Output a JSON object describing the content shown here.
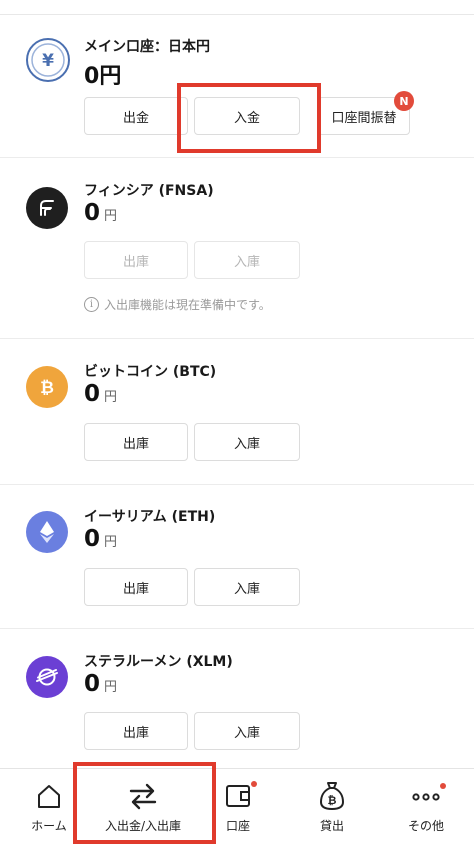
{
  "main_account": {
    "title": "メイン口座：日本円",
    "balance_num": "0",
    "balance_unit": "円",
    "withdraw_label": "出金",
    "deposit_label": "入金",
    "transfer_label": "口座間振替",
    "transfer_badge": "N",
    "icon": "yen-icon"
  },
  "assets": [
    {
      "name": "フィンシア (FNSA)",
      "amount": "0",
      "unit": "円",
      "out_label": "出庫",
      "in_label": "入庫",
      "disabled": true,
      "notice_icon": "i",
      "notice": "入出庫機能は現在準備中です。",
      "icon": "finschia-icon",
      "color": "#1f1f1f"
    },
    {
      "name": "ビットコイン (BTC)",
      "amount": "0",
      "unit": "円",
      "out_label": "出庫",
      "in_label": "入庫",
      "icon": "bitcoin-icon",
      "color": "#f0a53c"
    },
    {
      "name": "イーサリアム (ETH)",
      "amount": "0",
      "unit": "円",
      "out_label": "出庫",
      "in_label": "入庫",
      "icon": "ethereum-icon",
      "color": "#6a7fe0"
    },
    {
      "name": "ステラルーメン (XLM)",
      "amount": "0",
      "unit": "円",
      "out_label": "出庫",
      "in_label": "入庫",
      "icon": "stellar-icon",
      "color": "#6b3fd4"
    }
  ],
  "tabbar": {
    "items": [
      {
        "label": "ホーム",
        "icon": "home-icon"
      },
      {
        "label": "入出金/入出庫",
        "icon": "transfer-arrows-icon",
        "active": true
      },
      {
        "label": "口座",
        "icon": "wallet-icon",
        "dot": true
      },
      {
        "label": "貸出",
        "icon": "money-bag-icon"
      },
      {
        "label": "その他",
        "icon": "more-dots-icon",
        "dot": true
      }
    ]
  },
  "colors": {
    "highlight": "#e03a2c",
    "badge": "#e24b3b",
    "main_icon": "#4a6fb0"
  }
}
